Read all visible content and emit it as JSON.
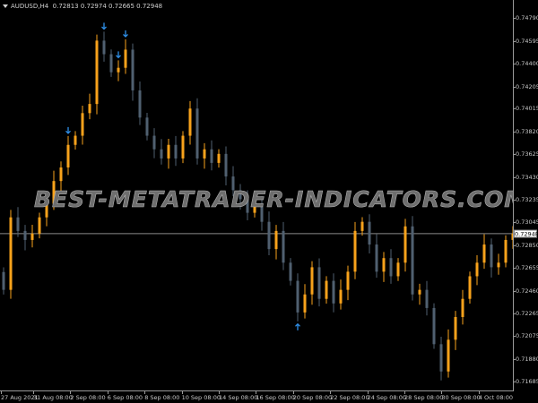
{
  "header": {
    "symbol": "AUDUSD,H4",
    "ohlc": "0.72813 0.72974 0.72665 0.72948"
  },
  "watermark": "BEST-METATRADER-INDICATORS.COM",
  "current_price": "0.72948",
  "colors": {
    "bull": "#f7a21b",
    "bear": "#506070",
    "arrow": "#2f8fe8",
    "price_line": "#8a8a8a"
  },
  "chart_data": {
    "type": "candlestick",
    "ylim": [
      0.7159,
      0.7484
    ],
    "y_ticks": [
      "0.74790",
      "0.74595",
      "0.74400",
      "0.74205",
      "0.74015",
      "0.73820",
      "0.73625",
      "0.73430",
      "0.73235",
      "0.73045",
      "0.72850",
      "0.72655",
      "0.72460",
      "0.72265",
      "0.72075",
      "0.71880",
      "0.71685"
    ],
    "x_ticks": [
      "27 Aug 2021",
      "31 Aug 08:00",
      "2 Sep 08:00",
      "6 Sep 08:00",
      "8 Sep 08:00",
      "10 Sep 08:00",
      "14 Sep 08:00",
      "16 Sep 08:00",
      "20 Sep 08:00",
      "22 Sep 08:00",
      "24 Sep 08:00",
      "28 Sep 08:00",
      "30 Sep 08:00",
      "4 Oct 08:00"
    ],
    "first_open": 0.7262,
    "closes": [
      0.72468,
      0.73087,
      0.72971,
      0.72894,
      0.72948,
      0.73087,
      0.73203,
      0.73397,
      0.73513,
      0.73706,
      0.73784,
      0.73977,
      0.74055,
      0.74596,
      0.7448,
      0.74326,
      0.74364,
      0.74519,
      0.74171,
      0.73939,
      0.73784,
      0.73668,
      0.7359,
      0.73706,
      0.7359,
      0.73784,
      0.74016,
      0.7359,
      0.73668,
      0.73552,
      0.73629,
      0.73436,
      0.73319,
      0.73242,
      0.73126,
      0.73203,
      0.73049,
      0.72816,
      0.72971,
      0.727,
      0.72545,
      0.72275,
      0.72429,
      0.72661,
      0.72391,
      0.72545,
      0.72352,
      0.72468,
      0.72623,
      0.72971,
      0.73049,
      0.72855,
      0.72623,
      0.72739,
      0.72584,
      0.727,
      0.7301,
      0.72429,
      0.72468,
      0.72313,
      0.72004,
      0.71771,
      0.72042,
      0.72236,
      0.72391,
      0.72584,
      0.727,
      0.72855,
      0.72661,
      0.727,
      0.72894,
      0.72948
    ],
    "signals": [
      {
        "index": 9,
        "dir": "down"
      },
      {
        "index": 14,
        "dir": "down"
      },
      {
        "index": 16,
        "dir": "down"
      },
      {
        "index": 17,
        "dir": "down"
      },
      {
        "index": 41,
        "dir": "up"
      }
    ]
  }
}
